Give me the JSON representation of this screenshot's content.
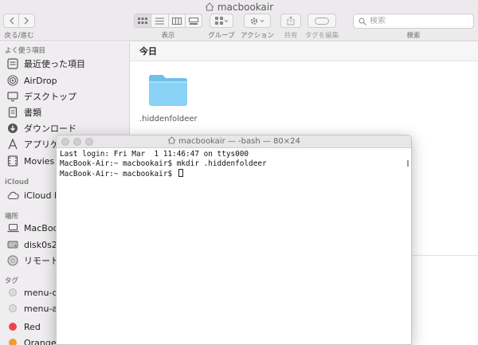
{
  "finder": {
    "title": "macbookair",
    "toolbar": {
      "back_forward_label": "戻る/進む",
      "view_label": "表示",
      "group_label": "グループ",
      "action_label": "アクション",
      "share_label": "共有",
      "tag_label": "タグを編集",
      "search_label": "検索",
      "search_placeholder": "検索"
    },
    "sidebar": {
      "favorites_header": "よく使う項目",
      "favorites": [
        {
          "label": "最近使った項目",
          "icon": "clock-icon"
        },
        {
          "label": "AirDrop",
          "icon": "airdrop-icon"
        },
        {
          "label": "デスクトップ",
          "icon": "desktop-icon"
        },
        {
          "label": "書類",
          "icon": "document-icon"
        },
        {
          "label": "ダウンロード",
          "icon": "download-icon"
        },
        {
          "label": "アプリケ",
          "icon": "applications-icon"
        },
        {
          "label": "Movies",
          "icon": "movies-icon"
        }
      ],
      "icloud_header": "iCloud",
      "icloud": [
        {
          "label": "iCloud D",
          "icon": "icloud-icon"
        }
      ],
      "locations_header": "場所",
      "locations": [
        {
          "label": "MacBoo",
          "icon": "laptop-icon"
        },
        {
          "label": "disk0s2",
          "icon": "disk-icon"
        },
        {
          "label": "リモート",
          "icon": "remote-disc-icon"
        }
      ],
      "tags_header": "タグ",
      "tags": [
        {
          "label": "menu-o",
          "color": "#d9d9d9"
        },
        {
          "label": "menu-a",
          "color": "#d9d9d9"
        },
        {
          "label": "Red",
          "color": "#f0444a"
        },
        {
          "label": "Orange",
          "color": "#f29b32"
        }
      ]
    },
    "content": {
      "section_header": "今日",
      "folder_name": ".hiddenfoldeer",
      "folder_color": "#7ccaf1"
    }
  },
  "terminal": {
    "title": "macbookair — -bash — 80×24",
    "lines": [
      "Last login: Fri Mar  1 11:46:47 on ttys000",
      "MacBook-Air:~ macbookair$ mkdir .hiddenfoldeer",
      "MacBook-Air:~ macbookair$ "
    ]
  }
}
